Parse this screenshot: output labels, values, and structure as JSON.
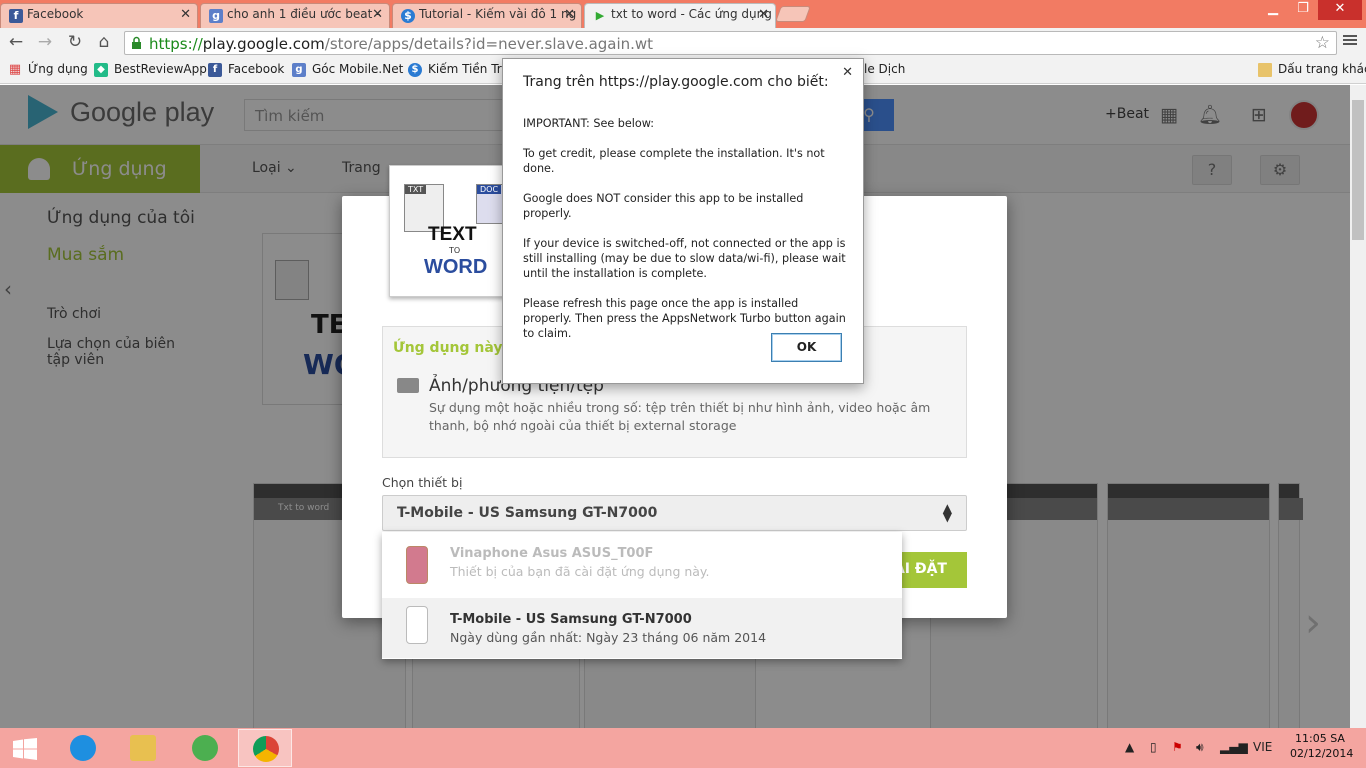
{
  "browser": {
    "tabs": [
      {
        "label": "Facebook",
        "icon": "facebook-icon",
        "color": "#3b5998",
        "glyph": "f"
      },
      {
        "label": "cho anh 1 điều ước beat -",
        "icon": "google-plus-icon",
        "color": "#5d7fc9",
        "glyph": "g"
      },
      {
        "label": "Tutorial - Kiếm vài đô 1 ng",
        "icon": "dollar-icon",
        "color": "#2a7bd3",
        "glyph": "$"
      },
      {
        "label": "txt to word - Các ứng dụng",
        "icon": "play-icon",
        "color": "#5cb85c",
        "glyph": "▶"
      }
    ],
    "url": {
      "scheme": "https://",
      "host": "play.google.com",
      "path": "/store/apps/details?id=never.slave.again.wt"
    },
    "bookmarks": [
      {
        "label": "Ứng dụng",
        "icon": "apps-grid-icon",
        "color": "#d44"
      },
      {
        "label": "BestReviewApp",
        "icon": "cube-icon",
        "color": "#2b8"
      },
      {
        "label": "Facebook",
        "icon": "facebook-icon",
        "color": "#3b5998"
      },
      {
        "label": "Góc Mobile.Net",
        "icon": "google-plus-icon",
        "color": "#5d7fc9"
      },
      {
        "label": "Kiếm Tiền Trê",
        "icon": "dollar-icon",
        "color": "#2a7bd3"
      }
    ],
    "bookmark_partial": "le Dịch",
    "other_bookmarks": "Dấu trang khác"
  },
  "play": {
    "logo": "Google play",
    "search_placeholder": "Tìm kiếm",
    "user": "+Beat",
    "category": "Ứng dụng",
    "subnav": [
      "Loại",
      "Trang"
    ],
    "sidebar": [
      "Ứng dụng của tôi",
      "Mua sắm",
      "Trò chơi",
      "Lựa chọn của biên tập viên"
    ],
    "card_text": [
      "TE",
      "WO"
    ],
    "shots": [
      "Txt to word",
      "",
      "",
      "",
      "",
      "",
      ""
    ]
  },
  "modal": {
    "icon_text": {
      "top": "TEXT",
      "mid": "TO",
      "bottom": "WORD",
      "txt": "TXT",
      "doc": "DOC"
    },
    "perm_header": "Ứng dụng này có",
    "perm_title": "Ảnh/phương tiện/tệp",
    "perm_desc": "Sự dụng một hoặc nhiều trong số: tệp trên thiết bị như hình ảnh, video hoặc âm thanh, bộ nhớ ngoài của thiết bị external storage",
    "device_label": "Chọn thiết bị",
    "device_selected": "T-Mobile - US Samsung GT-N7000",
    "install_label": "ÀI ĐẶT",
    "devices": [
      {
        "name": "Vinaphone Asus ASUS_T00F",
        "sub": "Thiết bị của bạn đã cài đặt ứng dụng này."
      },
      {
        "name": "T-Mobile - US Samsung GT-N7000",
        "sub": "Ngày dùng gần nhất: Ngày 23 tháng 06 năm 2014"
      }
    ]
  },
  "alert": {
    "title": "Trang trên https://play.google.com cho biết:",
    "lines": [
      "IMPORTANT: See below:",
      "To get credit, please complete the installation. It's not done.",
      "Google does NOT consider this app to be installed properly.",
      "If your device is switched-off, not connected or the app is still installing (may be due to slow data/wi-fi), please wait until the installation is complete.",
      "Please refresh this page once the app is installed properly. Then press the AppsNetwork Turbo button again to claim."
    ],
    "ok": "OK"
  },
  "taskbar": {
    "lang": "VIE",
    "time": "11:05 SA",
    "date": "02/12/2014"
  }
}
